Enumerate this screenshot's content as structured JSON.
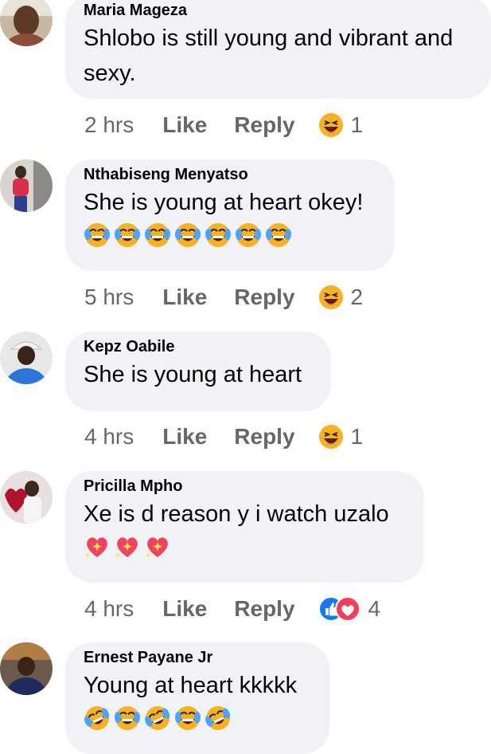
{
  "comments": [
    {
      "author": "Maria Mageza",
      "lines": [
        "Shlobo is still young and vibrant and",
        "sexy."
      ],
      "emojis": [],
      "time": "2 hrs",
      "like": "Like",
      "reply": "Reply",
      "reaction_icon": "haha-reaction-icon",
      "reaction_count": "1"
    },
    {
      "author": "Nthabiseng Menyatso",
      "lines": [
        "She is young at heart okey!"
      ],
      "emojis": [
        "tears-of-joy-emoji",
        "tears-of-joy-emoji",
        "tears-of-joy-emoji",
        "tears-of-joy-emoji",
        "tears-of-joy-emoji",
        "tears-of-joy-emoji",
        "tears-of-joy-emoji"
      ],
      "time": "5 hrs",
      "like": "Like",
      "reply": "Reply",
      "reaction_icon": "haha-reaction-icon",
      "reaction_count": "2"
    },
    {
      "author": "Kepz Oabile",
      "lines": [
        "She is young at heart"
      ],
      "emojis": [],
      "time": "4 hrs",
      "like": "Like",
      "reply": "Reply",
      "reaction_icon": "haha-reaction-icon",
      "reaction_count": "1"
    },
    {
      "author": "Pricilla Mpho",
      "lines": [
        "Xe is d reason y i watch uzalo"
      ],
      "emojis": [
        "sparkling-heart-emoji",
        "sparkling-heart-emoji",
        "sparkling-heart-emoji"
      ],
      "time": "4 hrs",
      "like": "Like",
      "reply": "Reply",
      "reaction_icon": "like-love-reaction-icon",
      "reaction_count": "4"
    },
    {
      "author": "Ernest Payane Jr",
      "lines": [
        "Young at heart kkkkk"
      ],
      "emojis": [
        "rolling-laughing-emoji",
        "tears-of-joy-emoji",
        "rolling-laughing-emoji",
        "tears-of-joy-emoji",
        "rolling-laughing-emoji"
      ],
      "time": "",
      "like": "",
      "reply": "",
      "reaction_icon": "",
      "reaction_count": ""
    }
  ],
  "colors": {
    "bubble": "#f0f2f5",
    "meta_text": "#65676b",
    "like_blue": "#1877f2",
    "love_red": "#f33e58",
    "haha_yellow": "#f7b125"
  }
}
